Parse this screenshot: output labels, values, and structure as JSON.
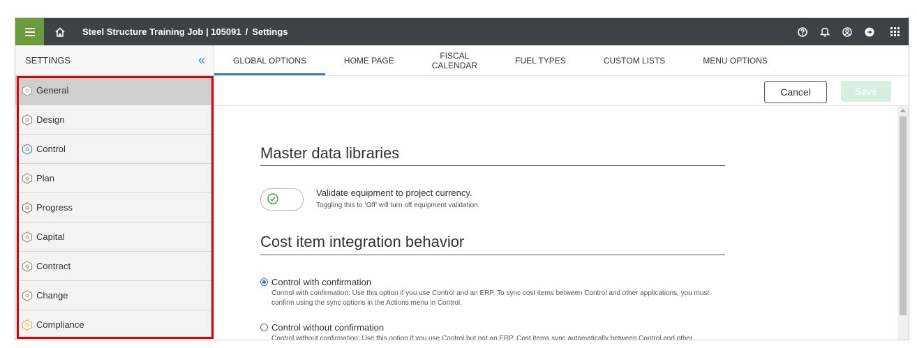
{
  "topbar": {
    "job": "Steel Structure Training Job | 105091",
    "separator": "/",
    "page": "Settings"
  },
  "icons": {
    "menu": "hamburger-icon",
    "home": "home-icon",
    "help": "help-circle-icon",
    "notifications": "bell-icon",
    "account": "user-circle-icon",
    "signout": "sign-out-icon",
    "apps": "app-grid-icon"
  },
  "sidebar": {
    "header": "SETTINGS",
    "collapse": "«",
    "items": [
      {
        "label": "General",
        "icon": "general-hex-icon",
        "color": "#9aa89a"
      },
      {
        "label": "Design",
        "icon": "design-hex-icon",
        "color": "#8a8a8a"
      },
      {
        "label": "Control",
        "icon": "control-hex-icon",
        "color": "#4a7fc0"
      },
      {
        "label": "Plan",
        "icon": "plan-hex-icon",
        "color": "#8a8a8a"
      },
      {
        "label": "Progress",
        "icon": "progress-hex-icon",
        "color": "#6a6a6a"
      },
      {
        "label": "Capital",
        "icon": "capital-hex-icon",
        "color": "#8a8a8a"
      },
      {
        "label": "Contract",
        "icon": "contract-hex-icon",
        "color": "#8a8a8a"
      },
      {
        "label": "Change",
        "icon": "change-hex-icon",
        "color": "#8a8a8a"
      },
      {
        "label": "Compliance",
        "icon": "compliance-hex-icon",
        "color": "#f0a050"
      }
    ]
  },
  "tabs": [
    {
      "label": "GLOBAL OPTIONS",
      "active": true
    },
    {
      "label": "HOME PAGE"
    },
    {
      "label": "FISCAL\nCALENDAR"
    },
    {
      "label": "FUEL TYPES"
    },
    {
      "label": "CUSTOM LISTS"
    },
    {
      "label": "MENU OPTIONS"
    }
  ],
  "actions": {
    "cancel": "Cancel",
    "save": "Save"
  },
  "sections": {
    "master": {
      "title": "Master data libraries",
      "toggle_label": "Validate equipment to project currency.",
      "toggle_hint": "Toggling this to ‘Off’ will turn off equipment validation."
    },
    "cost": {
      "title": "Cost item integration behavior",
      "options": [
        {
          "label": "Control with confirmation",
          "desc": "Control with confirmation: Use this option if you use Control and an ERP. To sync cost items between Control and other applications, you must confirm using the sync options in the Actions menu in Control.",
          "checked": true
        },
        {
          "label": "Control without confirmation",
          "desc": "Control without confirmation: Use this option if you use Control but not an ERP. Cost items sync automatically between Control and other applications.",
          "checked": false
        }
      ]
    }
  },
  "colors": {
    "topbar": "#3e4247",
    "menu_accent": "#6a9c3b",
    "tab_accent": "#3f76c5",
    "highlight": "#e00000"
  }
}
